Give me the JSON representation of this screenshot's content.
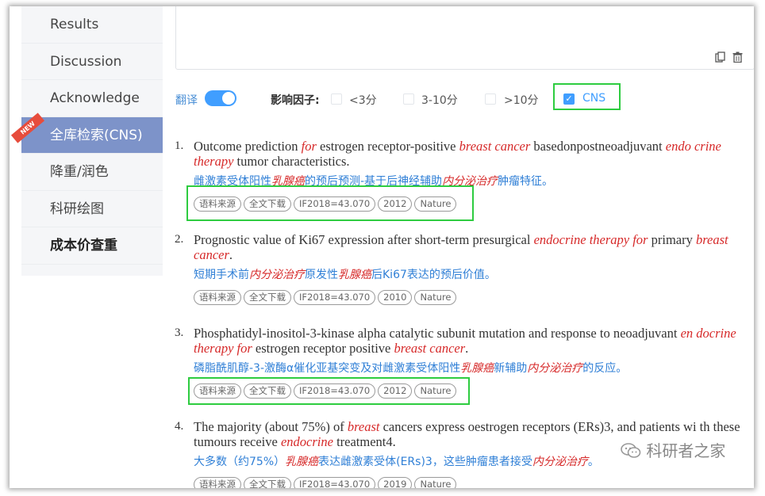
{
  "sidebar": {
    "items": [
      {
        "label": "Results"
      },
      {
        "label": "Discussion"
      },
      {
        "label": "Acknowledge"
      },
      {
        "label": "全库检索(CNS)",
        "active": true,
        "badge": "NEW"
      },
      {
        "label": "降重/润色"
      },
      {
        "label": "科研绘图"
      },
      {
        "label": "成本价查重"
      }
    ]
  },
  "textarea": {
    "value": "",
    "icons": [
      "copy-icon",
      "trash-icon"
    ]
  },
  "filters": {
    "translate_label": "翻译",
    "translate_on": true,
    "impact_label": "影响因子:",
    "options": [
      {
        "label": "<3分",
        "checked": false
      },
      {
        "label": "3-10分",
        "checked": false
      },
      {
        "label": ">10分",
        "checked": false
      },
      {
        "label": "CNS",
        "checked": true
      }
    ]
  },
  "results": [
    {
      "num": "1.",
      "title": [
        "Outcome prediction ",
        "for",
        " estrogen receptor-positive ",
        "breast cancer",
        " basedonpostneoadjuvant ",
        "endo crine therapy",
        " tumor characteristics."
      ],
      "cn": [
        "雌激素受体阳性",
        "乳腺癌",
        "的预后预测-基于后神经辅助",
        "内分泌治疗",
        "肿瘤特征。"
      ],
      "tags": [
        "语料来源",
        "全文下载",
        "IF2018=43.070",
        "2012",
        "Nature"
      ]
    },
    {
      "num": "2.",
      "title": [
        "Prognostic value of Ki67 expression after short-term presurgical ",
        "endocrine therapy for",
        " primary ",
        "breast cancer",
        "."
      ],
      "cn": [
        "短期手术前",
        "内分泌治疗",
        "原发性",
        "乳腺癌",
        "后Ki67表达的预后价值。"
      ],
      "tags": [
        "语料来源",
        "全文下载",
        "IF2018=43.070",
        "2010",
        "Nature"
      ]
    },
    {
      "num": "3.",
      "title": [
        "Phosphatidyl-inositol-3-kinase alpha catalytic subunit mutation and response to neoadjuvant ",
        "en docrine therapy for",
        " estrogen receptor positive ",
        "breast cancer",
        "."
      ],
      "cn": [
        "磷脂酰肌醇-3-激酶α催化亚基突变及对雌激素受体阳性",
        "乳腺癌",
        "新辅助",
        "内分泌治疗",
        "的反应。"
      ],
      "tags": [
        "语料来源",
        "全文下载",
        "IF2018=43.070",
        "2012",
        "Nature"
      ]
    },
    {
      "num": "4.",
      "title": [
        "The majority (about 75%) of ",
        "breast",
        " cancers express oestrogen receptors (ERs)3, and patients wi th these tumours receive ",
        "endocrine",
        " treatment4."
      ],
      "cn": [
        "大多数（约75%）",
        "乳腺癌",
        "表达雌激素受体(ERs)3，这些肿瘤患者接受",
        "内分泌治疗",
        "。"
      ],
      "tags": [
        "语料来源",
        "全文下载",
        "IF2018=43.070",
        "2019",
        "Nature"
      ]
    }
  ],
  "watermark": {
    "text": "科研者之家"
  }
}
